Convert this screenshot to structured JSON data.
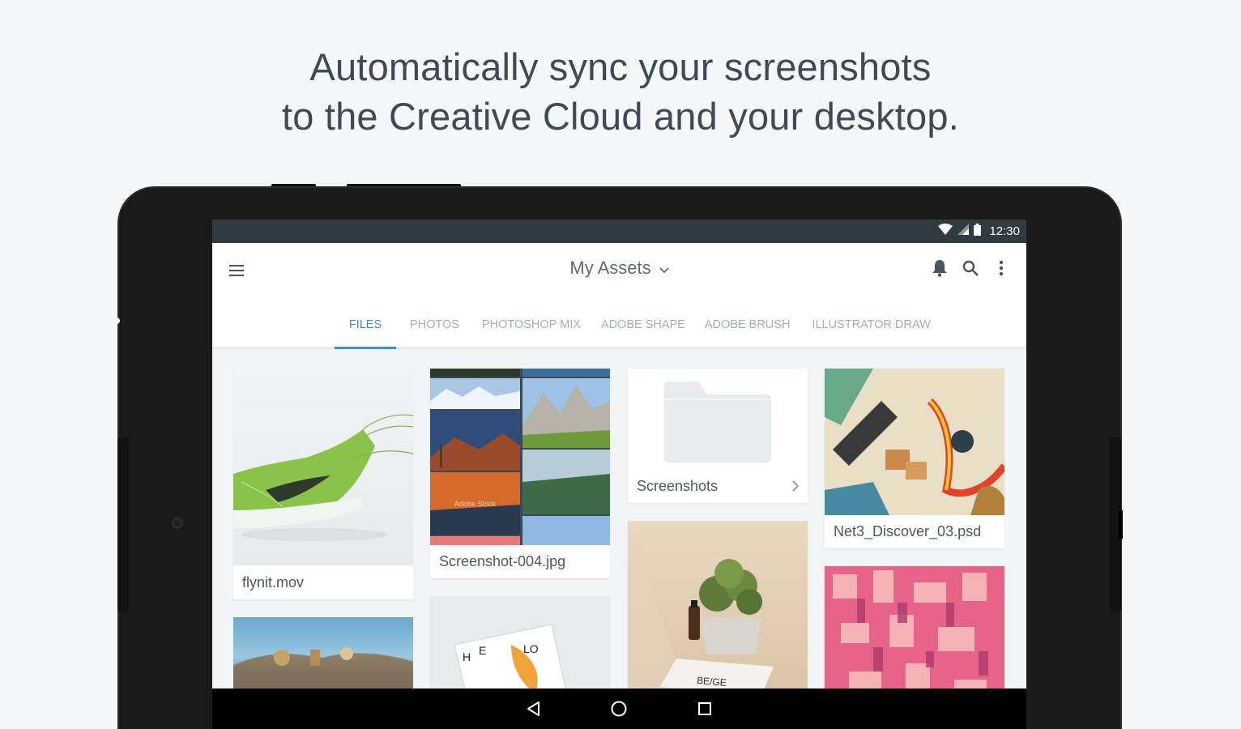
{
  "headline": {
    "line1": "Automatically sync your screenshots",
    "line2": "to the Creative Cloud and your desktop."
  },
  "statusbar": {
    "time": "12:30",
    "icons": [
      "wifi-icon",
      "signal-icon",
      "battery-icon"
    ]
  },
  "appbar": {
    "title": "My Assets",
    "menu_icon": "hamburger-menu-icon",
    "actions": [
      "bell-icon",
      "search-icon",
      "more-vert-icon"
    ]
  },
  "tabs": [
    {
      "label": "FILES",
      "active": true
    },
    {
      "label": "PHOTOS",
      "active": false
    },
    {
      "label": "PHOTOSHOP MIX",
      "active": false
    },
    {
      "label": "ADOBE SHAPE",
      "active": false
    },
    {
      "label": "ADOBE BRUSH",
      "active": false
    },
    {
      "label": "ILLUSTRATOR DRAW",
      "active": false
    }
  ],
  "files": [
    {
      "name": "flynit.mov",
      "thumb": "green-sneaker-image"
    },
    {
      "name": "Screenshot-004.jpg",
      "thumb": "landscape-collage-image"
    },
    {
      "name": "Screenshots",
      "thumb": "folder-icon"
    },
    {
      "name": "Net3_Discover_03.psd",
      "thumb": "illustration-image"
    },
    {
      "name": "",
      "thumb": "island-illustration-image"
    },
    {
      "name": "",
      "thumb": "magazine-mockup-image"
    },
    {
      "name": "",
      "thumb": "beige-product-photo"
    },
    {
      "name": "",
      "thumb": "isometric-city-image"
    }
  ],
  "mockup_labels": {
    "stock_watermark": "Adobe Stock",
    "beige_text": "BE/GE"
  },
  "navbar": [
    "back-icon",
    "home-icon",
    "recents-icon"
  ],
  "colors": {
    "accent": "#3b8ed6",
    "statusbar": "#303a41",
    "background": "#f5f7f8"
  }
}
